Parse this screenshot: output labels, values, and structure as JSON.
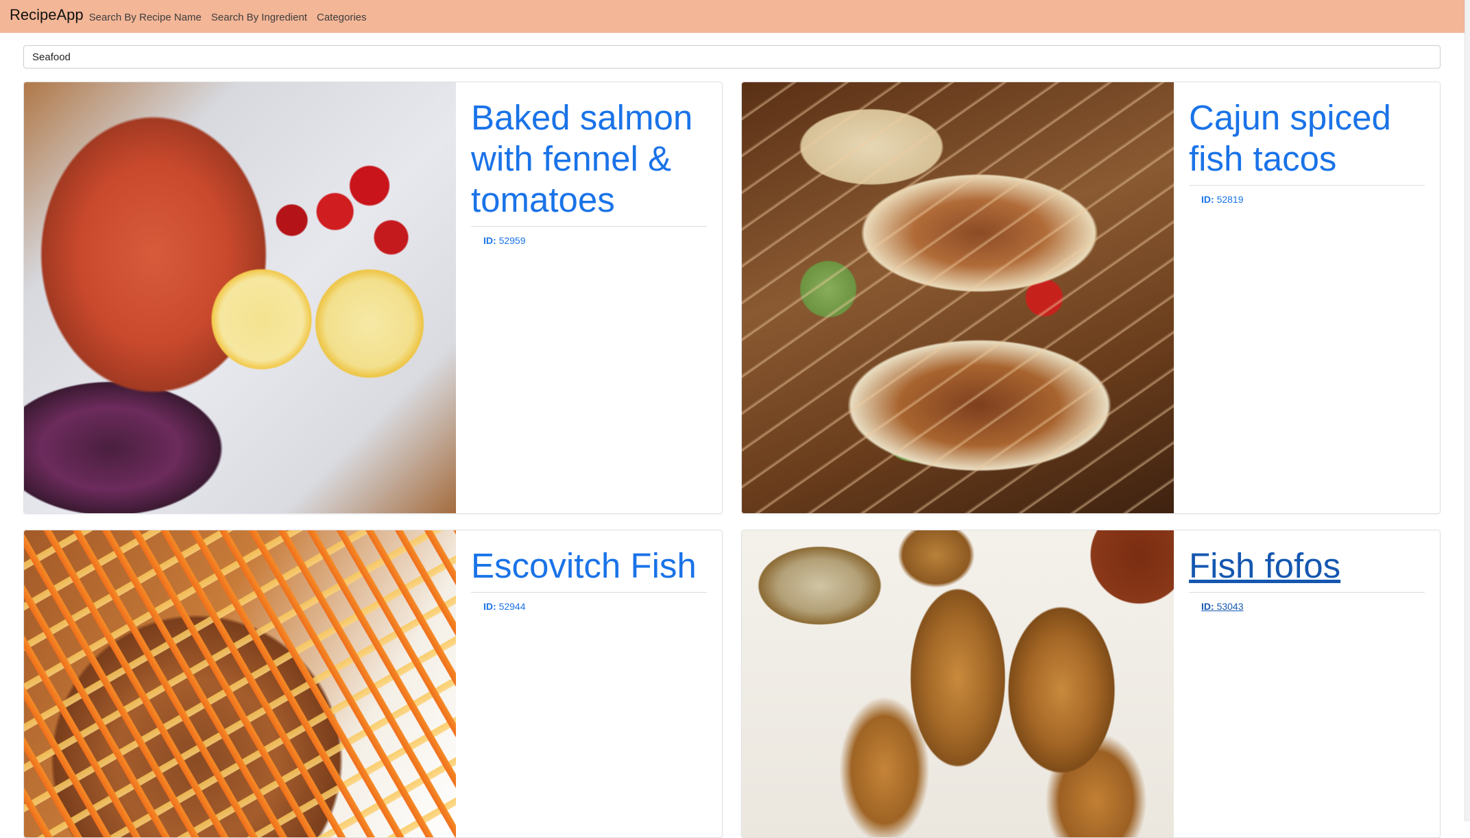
{
  "navbar": {
    "brand": "RecipeApp",
    "links": [
      "Search By Recipe Name",
      "Search By Ingredient",
      "Categories"
    ],
    "color": "#f3b697"
  },
  "search": {
    "value": "Seafood"
  },
  "cards": [
    {
      "title": "Baked salmon with fennel & tomatoes",
      "id_label": "ID:",
      "id_value": "52959",
      "image_icon": "salmon-photo"
    },
    {
      "title": "Cajun spiced fish tacos",
      "id_label": "ID:",
      "id_value": "52819",
      "image_icon": "tacos-photo"
    },
    {
      "title": "Escovitch Fish",
      "id_label": "ID:",
      "id_value": "52944",
      "image_icon": "escovitch-photo"
    },
    {
      "title": "Fish fofos",
      "id_label": "ID:",
      "id_value": "53043",
      "image_icon": "fofos-photo"
    }
  ],
  "accent_color": "#1a73e8"
}
